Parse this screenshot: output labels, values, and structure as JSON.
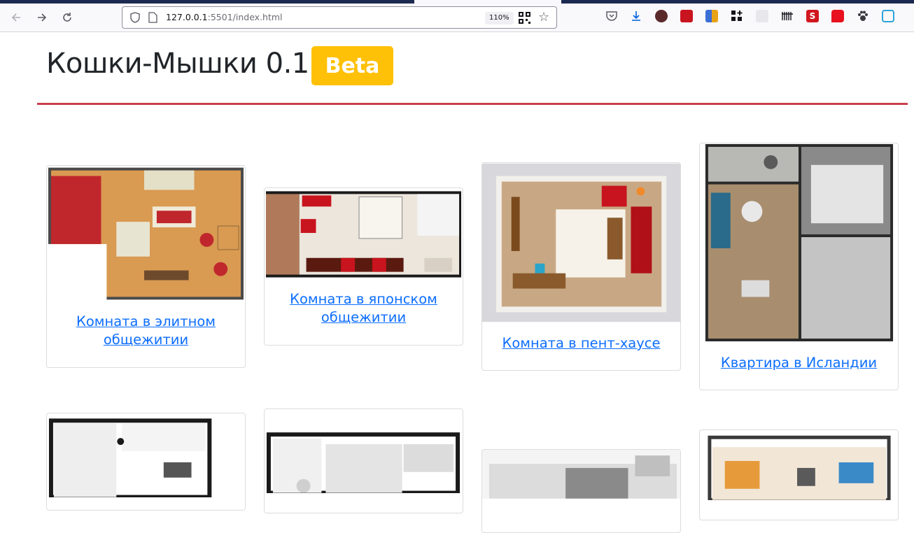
{
  "browser": {
    "url_host": "127.0.0.1",
    "url_rest": ":5501/index.html",
    "zoom": "110%",
    "icons": [
      "back-arrow-icon",
      "forward-arrow-icon",
      "reload-icon",
      "shield-icon",
      "page-icon",
      "qr-code-icon",
      "star-icon",
      "pocket-icon",
      "download-icon"
    ]
  },
  "header": {
    "title": "Кошки-Мышки 0.1",
    "badge": "Beta"
  },
  "colors": {
    "badge": "#ffc107",
    "rule": "#c9404c",
    "link": "#0d6efd"
  },
  "cards": [
    {
      "caption": "Комната в элитном общежитии"
    },
    {
      "caption": "Комната в японском общежитии"
    },
    {
      "caption": "Комната в пент-хаусе"
    },
    {
      "caption": "Квартира в Исландии"
    },
    {
      "caption": ""
    },
    {
      "caption": ""
    },
    {
      "caption": ""
    },
    {
      "caption": ""
    }
  ]
}
